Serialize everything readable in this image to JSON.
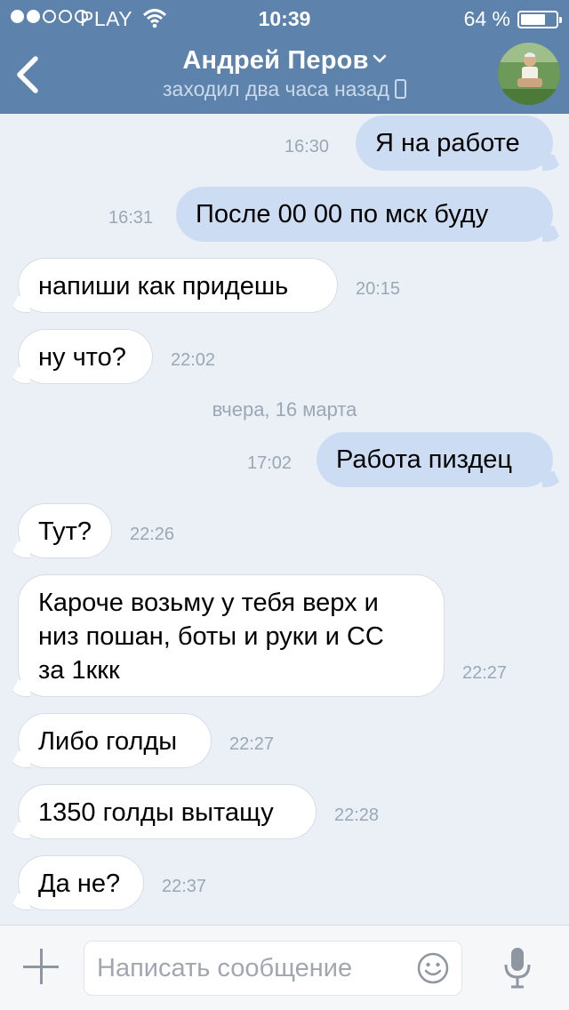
{
  "status_bar": {
    "carrier": "PLAY",
    "time": "10:39",
    "battery_percent": "64 %",
    "signal_bars_filled": 2,
    "signal_bars_total": 5,
    "battery_level": 0.64
  },
  "header": {
    "name": "Андрей Перов",
    "status": "заходил два часа назад",
    "colors": {
      "bar": "#5d83ad"
    }
  },
  "messages": [
    {
      "dir": "out",
      "text": "Я на работе",
      "time": "16:30"
    },
    {
      "dir": "out",
      "text": "После 00 00 по мск буду",
      "time": "16:31"
    },
    {
      "dir": "in",
      "text": "напиши как придешь",
      "time": "20:15"
    },
    {
      "dir": "in",
      "text": "ну что?",
      "time": "22:02"
    },
    {
      "dir": "out",
      "text": "Работа пиздец",
      "time": "17:02"
    },
    {
      "dir": "in",
      "text": "Тут?",
      "time": "22:26"
    },
    {
      "dir": "in",
      "text_lines": [
        "Кароче возьму у тебя верх и",
        "низ пошан, боты и руки и СС",
        "за 1ккк"
      ],
      "time": "22:27"
    },
    {
      "dir": "in",
      "text": "Либо голды",
      "time": "22:27"
    },
    {
      "dir": "in",
      "text": "1350 голды вытащу",
      "time": "22:28"
    },
    {
      "dir": "in",
      "text": "Да не?",
      "time": "22:37"
    }
  ],
  "date_separator": "вчера, 16 марта",
  "composer": {
    "placeholder": "Написать сообщение",
    "icons": [
      "plus-icon",
      "smile-icon",
      "microphone-icon"
    ]
  }
}
